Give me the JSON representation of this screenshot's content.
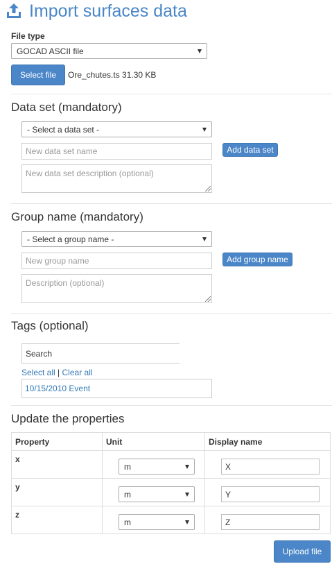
{
  "header": {
    "title": "Import surfaces data",
    "icon": "upload-icon",
    "accent": "#4a86c8"
  },
  "file": {
    "type_label": "File type",
    "type_value": "GOCAD ASCII file",
    "select_button": "Select file",
    "file_info": "Ore_chutes.ts 31.30 KB"
  },
  "dataset": {
    "heading": "Data set (mandatory)",
    "select_value": "- Select a data set -",
    "name_placeholder": "New data set name",
    "desc_placeholder": "New data set description (optional)",
    "add_button": "Add data set"
  },
  "group": {
    "heading": "Group name (mandatory)",
    "select_value": "- Select a group name -",
    "name_placeholder": "New group name",
    "desc_placeholder": "Description (optional)",
    "add_button": "Add group name"
  },
  "tags": {
    "heading": "Tags (optional)",
    "search_placeholder": "Search",
    "select_all": "Select all",
    "separator": "|",
    "clear_all": "Clear all",
    "items": [
      "10/15/2010 Event"
    ]
  },
  "properties": {
    "heading": "Update the properties",
    "columns": [
      "Property",
      "Unit",
      "Display name"
    ],
    "rows": [
      {
        "property": "x",
        "unit": "m",
        "display": "X"
      },
      {
        "property": "y",
        "unit": "m",
        "display": "Y"
      },
      {
        "property": "z",
        "unit": "m",
        "display": "Z"
      }
    ]
  },
  "footer": {
    "upload_button": "Upload file"
  }
}
